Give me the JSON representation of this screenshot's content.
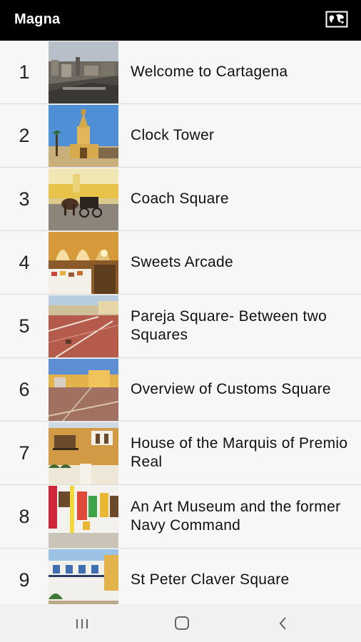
{
  "app": {
    "title": "Magna"
  },
  "tours": [
    {
      "number": "1",
      "title": "Welcome to Cartagena"
    },
    {
      "number": "2",
      "title": "Clock Tower"
    },
    {
      "number": "3",
      "title": "Coach Square"
    },
    {
      "number": "4",
      "title": "Sweets Arcade"
    },
    {
      "number": "5",
      "title": "Pareja Square- Between two Squares"
    },
    {
      "number": "6",
      "title": "Overview of Customs Square"
    },
    {
      "number": "7",
      "title": "House of the Marquis of Premio Real"
    },
    {
      "number": "8",
      "title": "An Art Museum and the former Navy Command"
    },
    {
      "number": "9",
      "title": "St Peter Claver Square"
    }
  ],
  "icons": {
    "map": "map-icon",
    "recents": "recents-icon",
    "home": "home-icon",
    "back": "back-icon"
  },
  "colors": {
    "topbar": "#000000",
    "background": "#f7f7f7",
    "divider": "#d9d9d9"
  }
}
